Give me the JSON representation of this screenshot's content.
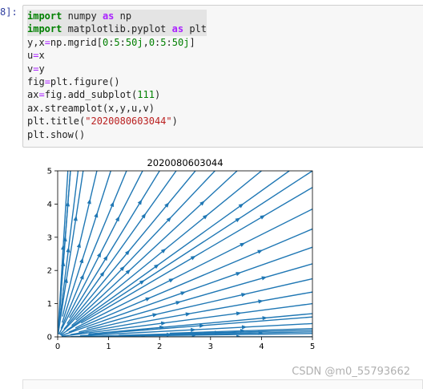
{
  "cell": {
    "prompt": "8]:",
    "lines": [
      {
        "pre": "",
        "kw1": "import",
        "mid": " numpy ",
        "op": "as",
        "post": " np"
      },
      {
        "pre": "",
        "kw1": "import",
        "mid": " matplotlib.pyplot ",
        "op": "as",
        "post": " plt"
      },
      {
        "pre": "y,x",
        "eq": "=",
        "mid": "np.mgrid[",
        "num1": "0",
        "mid2": ":",
        "num2": "5",
        "mid3": ":",
        "num3": "50j",
        "mid4": ",",
        "num4": "0",
        "mid5": ":",
        "num5": "5",
        "mid6": ":",
        "num6": "50j",
        "post": "]"
      },
      {
        "pre": "u",
        "eq": "=",
        "post": "x"
      },
      {
        "pre": "v",
        "eq": "=",
        "post": "y"
      },
      {
        "pre": "fig",
        "eq": "=",
        "post": "plt.figure()"
      },
      {
        "pre": "ax",
        "eq": "=",
        "mid": "fig.add_subplot(",
        "num1": "111",
        "post": ")"
      },
      {
        "pre": "ax.streamplot(x,y,u,v)"
      },
      {
        "pre": "plt.title(",
        "str": "\"2020080603044\"",
        "post": ")"
      },
      {
        "pre": "plt.show()"
      }
    ]
  },
  "chart_data": {
    "type": "streamplot",
    "title": "2020080603044",
    "xlim": [
      0,
      5
    ],
    "ylim": [
      0,
      5
    ],
    "xticks": [
      "0",
      "1",
      "2",
      "3",
      "4",
      "5"
    ],
    "yticks": [
      "0",
      "1",
      "2",
      "3",
      "4",
      "5"
    ],
    "field": {
      "u": "x",
      "v": "y"
    },
    "streamline_slopes": [
      0,
      0.03,
      0.08,
      0.14,
      0.2,
      0.27,
      0.35,
      0.44,
      0.54,
      0.65,
      0.77,
      0.9,
      1.0,
      1.1,
      1.25,
      1.42,
      1.62,
      1.85,
      2.15,
      2.5,
      3.0,
      3.7,
      4.8,
      6.5,
      10,
      20
    ],
    "color": "#1f77b4",
    "grid": false,
    "legend": "none"
  },
  "footer": {
    "watermark": "CSDN @m0_55793662"
  }
}
